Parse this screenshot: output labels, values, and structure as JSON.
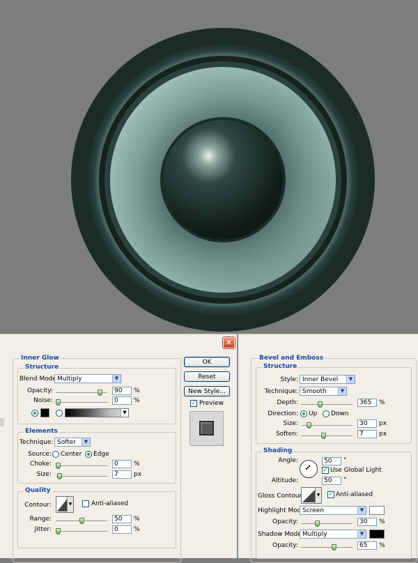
{
  "dialog": {
    "close_glyph": "✕"
  },
  "inner_glow": {
    "title": "Inner Glow",
    "structure": {
      "title": "Structure",
      "blend_mode_label": "Blend Mode:",
      "blend_mode": "Multiply",
      "opacity_label": "Opacity:",
      "opacity": "90",
      "opacity_unit": "%",
      "noise_label": "Noise:",
      "noise": "0",
      "noise_unit": "%",
      "opacity_level": 0.9,
      "noise_level": 0.0,
      "color": "#000000"
    },
    "elements": {
      "title": "Elements",
      "technique_label": "Technique:",
      "technique": "Softer",
      "source_label": "Source:",
      "source_center": "Center",
      "source_edge": "Edge",
      "choke_label": "Choke:",
      "choke": "0",
      "choke_unit": "%",
      "size_label": "Size:",
      "size": "7",
      "size_unit": "px",
      "choke_level": 0.0,
      "size_level": 0.03
    },
    "quality": {
      "title": "Quality",
      "contour_label": "Contour:",
      "anti_aliased_label": "Anti-aliased",
      "range_label": "Range:",
      "range": "50",
      "range_unit": "%",
      "jitter_label": "Jitter:",
      "jitter": "0",
      "jitter_unit": "%",
      "range_level": 0.5,
      "jitter_level": 0.0
    }
  },
  "buttons": {
    "ok": "OK",
    "reset": "Reset",
    "new_style": "New Style...",
    "preview": "Preview"
  },
  "bevel_emboss": {
    "title": "Bevel and Emboss",
    "structure": {
      "title": "Structure",
      "style_label": "Style:",
      "style": "Inner Bevel",
      "technique_label": "Technique:",
      "technique": "Smooth",
      "depth_label": "Depth:",
      "depth": "365",
      "depth_unit": "%",
      "direction_label": "Direction:",
      "direction_up": "Up",
      "direction_down": "Down",
      "size_label": "Size:",
      "size": "30",
      "size_unit": "px",
      "soften_label": "Soften:",
      "soften": "7",
      "soften_unit": "px",
      "depth_level": 0.36,
      "size_level": 0.12,
      "soften_level": 0.44
    },
    "shading": {
      "title": "Shading",
      "angle_label": "Angle:",
      "angle": "50",
      "angle_unit": "°",
      "use_global_light": "Use Global Light",
      "altitude_label": "Altitude:",
      "altitude": "50",
      "altitude_unit": "°",
      "gloss_contour_label": "Gloss Contour:",
      "anti_aliased_label": "Anti-aliased",
      "highlight_mode_label": "Highlight Mode:",
      "highlight_mode": "Screen",
      "highlight_color": "#ffffff",
      "highlight_opacity_label": "Opacity:",
      "highlight_opacity": "30",
      "highlight_opacity_unit": "%",
      "shadow_mode_label": "Shadow Mode:",
      "shadow_mode": "Multiply",
      "shadow_color": "#000000",
      "shadow_opacity_label": "Opacity:",
      "shadow_opacity": "65",
      "shadow_opacity_unit": "%",
      "highlight_opacity_level": 0.3,
      "shadow_opacity_level": 0.65
    }
  },
  "colors": {
    "canvas_bg": "#7d7d7d",
    "speaker_outer": "#1b2b26",
    "speaker_cone": "#4f6e66",
    "panel_bg": "#f1efe7",
    "group_title": "#1b47a8"
  }
}
